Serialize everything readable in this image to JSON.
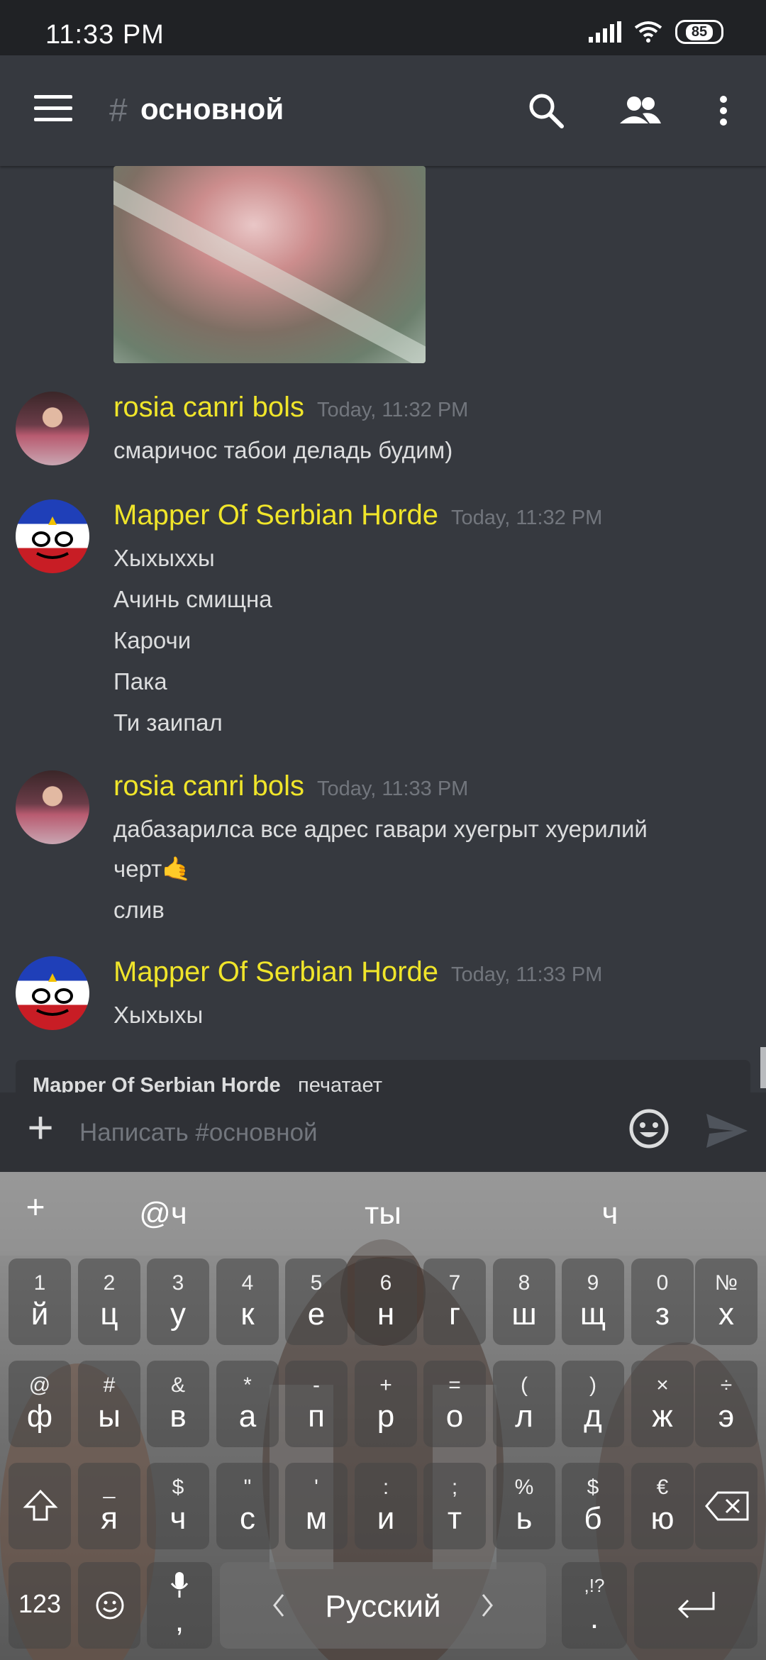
{
  "status_bar": {
    "time": "11:33 PM",
    "battery": "85"
  },
  "app_bar": {
    "hash": "#",
    "channel": "основной"
  },
  "messages": [
    {
      "author": "rosia canri bols",
      "timestamp": "Today, 11:32 PM",
      "lines": [
        "смаричос табои деладь будим)"
      ]
    },
    {
      "author": "Mapper Of Serbian Horde",
      "timestamp": "Today, 11:32 PM",
      "lines": [
        "Хыхыххы",
        "Ачинь смищна",
        "Карочи",
        "Пака",
        "Ти заипал"
      ]
    },
    {
      "author": "rosia canri bols",
      "timestamp": "Today, 11:33 PM",
      "lines": [
        "дабазарилса все адрес гавари хуегрыт хуерилий",
        "черт🤙",
        "слив"
      ]
    },
    {
      "author": "Mapper Of Serbian Horde",
      "timestamp": "Today, 11:33 PM",
      "lines": [
        "Хыхыхы"
      ]
    }
  ],
  "typing": {
    "name": "Mapper Of Serbian Horde",
    "text": "печатает"
  },
  "composer": {
    "placeholder": "Написать #основной"
  },
  "keyboard": {
    "suggestions": [
      "+",
      "@ч",
      "ты",
      "ч"
    ],
    "row1": [
      {
        "h": "1",
        "m": "й"
      },
      {
        "h": "2",
        "m": "ц"
      },
      {
        "h": "3",
        "m": "у"
      },
      {
        "h": "4",
        "m": "к"
      },
      {
        "h": "5",
        "m": "е"
      },
      {
        "h": "6",
        "m": "н"
      },
      {
        "h": "7",
        "m": "г"
      },
      {
        "h": "8",
        "m": "ш"
      },
      {
        "h": "9",
        "m": "щ"
      },
      {
        "h": "0",
        "m": "з"
      },
      {
        "h": "№",
        "m": "х"
      }
    ],
    "row2": [
      {
        "h": "@",
        "m": "ф"
      },
      {
        "h": "#",
        "m": "ы"
      },
      {
        "h": "&",
        "m": "в"
      },
      {
        "h": "*",
        "m": "а"
      },
      {
        "h": "-",
        "m": "п"
      },
      {
        "h": "+",
        "m": "р"
      },
      {
        "h": "=",
        "m": "о"
      },
      {
        "h": "(",
        "m": "л"
      },
      {
        "h": ")",
        "m": "д"
      },
      {
        "h": "×",
        "m": "ж"
      },
      {
        "h": "÷",
        "m": "э"
      }
    ],
    "row3": [
      {
        "h": "_",
        "m": "я"
      },
      {
        "h": "$",
        "m": "ч"
      },
      {
        "h": "\"",
        "m": "с"
      },
      {
        "h": "'",
        "m": "м"
      },
      {
        "h": ":",
        "m": "и"
      },
      {
        "h": ";",
        "m": "т"
      },
      {
        "h": "%",
        "m": "ь"
      },
      {
        "h": "$",
        "m": "б"
      },
      {
        "h": "€",
        "m": "ю"
      }
    ],
    "bottom": {
      "num": "123",
      "comma": ",",
      "space": "Русский",
      "punct": ",!?",
      "period": "."
    }
  }
}
